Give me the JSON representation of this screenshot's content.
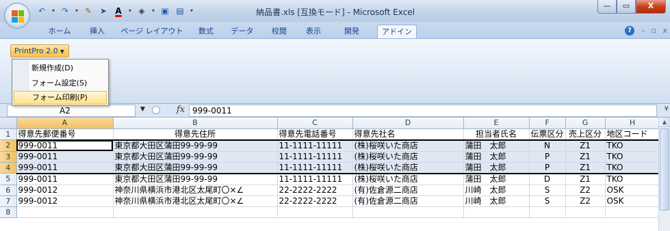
{
  "window": {
    "title": "納品書.xls  [互換モード] - Microsoft Excel",
    "minimize": "—",
    "restore": "▭",
    "close": "X"
  },
  "qat": {
    "icons": [
      "undo-icon",
      "redo-icon",
      "format-painter-icon",
      "cursor-icon",
      "font-color-icon",
      "fill-color-icon",
      "save-icon",
      "print-preview-icon"
    ]
  },
  "ribbon": {
    "tabs": [
      "ホーム",
      "挿入",
      "ページ レイアウト",
      "数式",
      "データ",
      "校閲",
      "表示",
      "開発",
      "アドイン"
    ],
    "active_tab": "アドイン",
    "help": "?",
    "min": "–",
    "restore": "▫",
    "close": "x"
  },
  "addin": {
    "button_label": "PrintPro 2.0",
    "caret": "▼",
    "menu": [
      {
        "label": "新規作成(D)",
        "highlighted": false
      },
      {
        "label": "フォーム設定(S)",
        "highlighted": false
      },
      {
        "label": "フォーム印刷(P)",
        "highlighted": true
      }
    ]
  },
  "formula_bar": {
    "name_box": "A2",
    "fx": "fx",
    "value": "999-0011",
    "expand": "¥"
  },
  "sheet": {
    "columns": [
      "A",
      "B",
      "C",
      "D",
      "E",
      "F",
      "G",
      "H"
    ],
    "row_numbers": [
      "1",
      "2",
      "3",
      "4",
      "5",
      "6",
      "7",
      "8"
    ],
    "rows": [
      [
        "得意先郵便番号",
        "得意先住所",
        "得意先電話番号",
        "得意先社名",
        "担当者氏名",
        "伝票区分",
        "売上区分",
        "地区コード"
      ],
      [
        "999-0011",
        "東京都大田区蒲田99-99-99",
        "11-1111-11111",
        "(株)桜咲いた商店",
        "蒲田　太郎",
        "N",
        "Z1",
        "TKO"
      ],
      [
        "999-0011",
        "東京都大田区蒲田99-99-99",
        "11-1111-11111",
        "(株)桜咲いた商店",
        "蒲田　太郎",
        "P",
        "Z1",
        "TKO"
      ],
      [
        "999-0011",
        "東京都大田区蒲田99-99-99",
        "11-1111-11111",
        "(株)桜咲いた商店",
        "蒲田　太郎",
        "P",
        "Z1",
        "TKO"
      ],
      [
        "999-0011",
        "東京都大田区蒲田99-99-99",
        "11-1111-11111",
        "(株)桜咲いた商店",
        "蒲田　太郎",
        "D",
        "Z1",
        "TKO"
      ],
      [
        "999-0012",
        "神奈川県横浜市港北区太尾町〇×∠",
        "22-2222-2222",
        "(有)佐倉源二商店",
        "川崎　太郎",
        "S",
        "Z2",
        "OSK"
      ],
      [
        "999-0012",
        "神奈川県横浜市港北区太尾町〇×∠",
        "22-2222-2222",
        "(有)佐倉源二商店",
        "川崎　太郎",
        "S",
        "Z2",
        "OSK"
      ],
      [
        "",
        "",
        "",
        "",
        "",
        "",
        "",
        ""
      ]
    ],
    "active_cell": "A2",
    "selected_rows": [
      "2",
      "3",
      "4"
    ]
  }
}
